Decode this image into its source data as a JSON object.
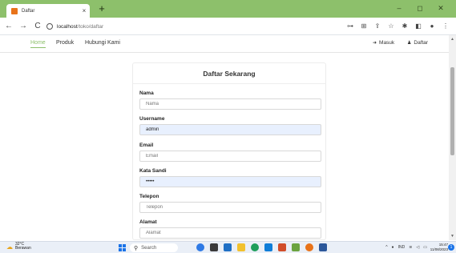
{
  "browser": {
    "tab_title": "Daftar",
    "tab_close": "×",
    "new_tab": "+",
    "win_min": "–",
    "win_max": "◻",
    "win_close": "✕",
    "back": "←",
    "forward": "→",
    "reload": "C",
    "url_host": "localhost",
    "url_path": "/toko/daftar",
    "accent_color": "#8dc06b"
  },
  "nav": {
    "home": "Home",
    "produk": "Produk",
    "hubungi": "Hubungi Kami",
    "masuk": "Masuk",
    "daftar": "Daftar"
  },
  "form": {
    "title": "Daftar Sekarang",
    "fields": [
      {
        "label": "Nama",
        "value": "",
        "placeholder": "Nama"
      },
      {
        "label": "Username",
        "value": "admin",
        "placeholder": "Username"
      },
      {
        "label": "Email",
        "value": "",
        "placeholder": "Email"
      },
      {
        "label": "Kata Sandi",
        "value": "•••••",
        "placeholder": "Kata Sandi"
      },
      {
        "label": "Telepon",
        "value": "",
        "placeholder": "Telepon"
      },
      {
        "label": "Alamat",
        "value": "",
        "placeholder": "Alamat"
      }
    ]
  },
  "taskbar": {
    "weather_temp": "32°C",
    "weather_desc": "Berawan",
    "search_placeholder": "Search",
    "tray_lang": "IND",
    "clock_time": "15:47",
    "clock_date": "11/08/2023",
    "notif_count": "1"
  }
}
